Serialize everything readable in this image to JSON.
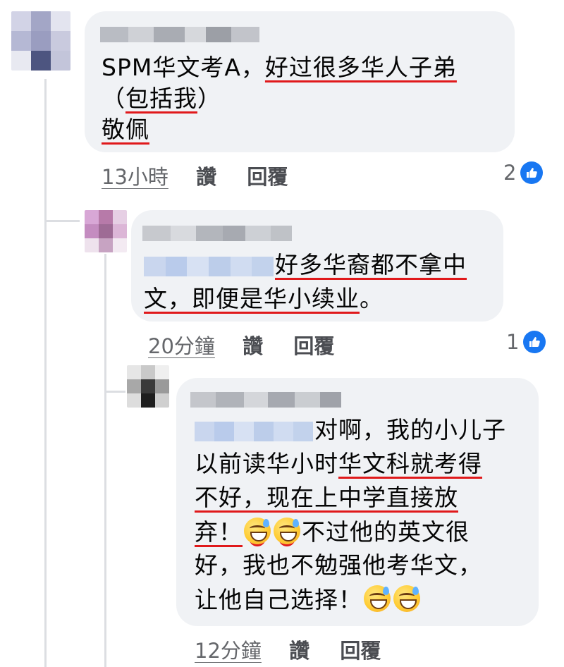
{
  "comments": [
    {
      "id": "c1",
      "lines": [
        [
          {
            "t": "SPM华文考A，"
          },
          {
            "t": "好过很多华人子弟",
            "u": true
          }
        ],
        [
          {
            "t": "（"
          },
          {
            "t": "包括我",
            "u": true
          },
          {
            "t": "）"
          }
        ],
        [
          {
            "t": "敬佩",
            "u": true
          }
        ]
      ],
      "time": "13小時",
      "like_label": "讚",
      "reply_label": "回覆",
      "reaction_count": "2"
    },
    {
      "id": "c2",
      "lines": [
        [
          {
            "mention": true
          },
          {
            "t": "好多华裔都不拿中",
            "u": true
          }
        ],
        [
          {
            "t": "文，即便是华小续业",
            "u": true
          },
          {
            "t": "。"
          }
        ]
      ],
      "time": "20分鐘",
      "like_label": "讚",
      "reply_label": "回覆",
      "reaction_count": "1"
    },
    {
      "id": "c3",
      "lines": [
        [
          {
            "mention": true
          },
          {
            "t": "对啊，我的小儿子"
          }
        ],
        [
          {
            "t": "以前读华小时"
          },
          {
            "t": "华文科就考得",
            "u": true
          }
        ],
        [
          {
            "t": "不好，现在上中学直接放",
            "u": true
          }
        ],
        [
          {
            "t": "弃！",
            "u": true
          },
          {
            "emoji": "grinning-sweat",
            "u": true
          },
          {
            "emoji": "grinning-sweat",
            "u": true
          },
          {
            "t": "不过他的英文很"
          }
        ],
        [
          {
            "t": "好，我也不勉强他考华文，"
          }
        ],
        [
          {
            "t": "让他自己选择！"
          },
          {
            "emoji": "grinning-sweat"
          },
          {
            "emoji": "grinning-sweat"
          }
        ]
      ],
      "time": "12分鐘",
      "like_label": "讚",
      "reply_label": "回覆",
      "reaction_count": null
    }
  ],
  "colors": {
    "bubble": "#f0f2f5",
    "underline": "#e0191b",
    "like_blue": "#1877f2",
    "meta_text": "#65676b"
  },
  "icons": {
    "reaction": "thumbs-up-icon",
    "emoji": "grinning-face-with-sweat"
  }
}
